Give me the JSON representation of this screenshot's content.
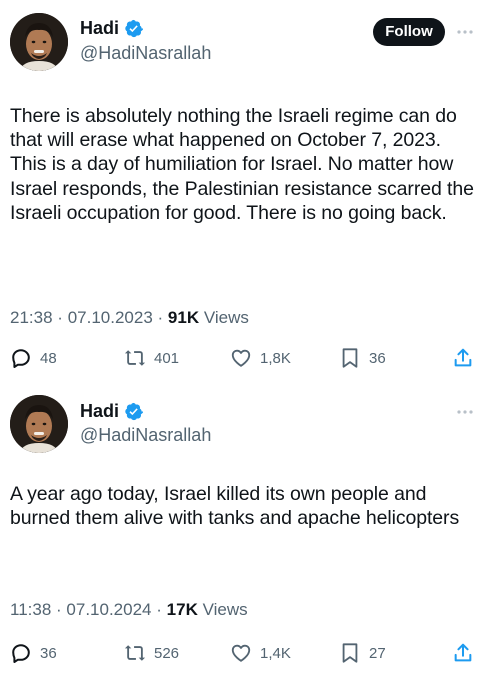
{
  "tweets": [
    {
      "author": {
        "display_name": "Hadi",
        "handle": "@HadiNasrallah",
        "verified": true
      },
      "follow_label": "Follow",
      "text": "There is absolutely nothing the Israeli regime can do that will erase what happened on October 7, 2023. This is a day of humiliation for Israel. No matter how Israel responds, the Palestinian resistance scarred the Israeli occupation for good. There is no going back.",
      "time": "21:38",
      "separator": "·",
      "date": "07.10.2023",
      "views_count": "91K",
      "views_label": "Views",
      "stats": {
        "replies": "48",
        "reposts": "401",
        "likes": "1,8K",
        "bookmarks": "36"
      }
    },
    {
      "author": {
        "display_name": "Hadi",
        "handle": "@HadiNasrallah",
        "verified": true
      },
      "text": "A year ago today, Israel killed its own people and burned them alive with tanks and apache helicopters",
      "time": "11:38",
      "separator": "·",
      "date": "07.10.2024",
      "views_count": "17K",
      "views_label": "Views",
      "stats": {
        "replies": "36",
        "reposts": "526",
        "likes": "1,4K",
        "bookmarks": "27"
      }
    }
  ],
  "icons": {
    "verified": "verified-badge-icon",
    "more": "more-dots-icon",
    "reply": "reply-bubble-icon",
    "repost": "repost-arrows-icon",
    "like": "heart-icon",
    "bookmark": "bookmark-icon",
    "share": "share-icon"
  },
  "colors": {
    "verified_blue": "#1d9bf0",
    "text_primary": "#0f1419",
    "text_secondary": "#536471",
    "follow_bg": "#0f1419",
    "background": "#ffffff"
  }
}
